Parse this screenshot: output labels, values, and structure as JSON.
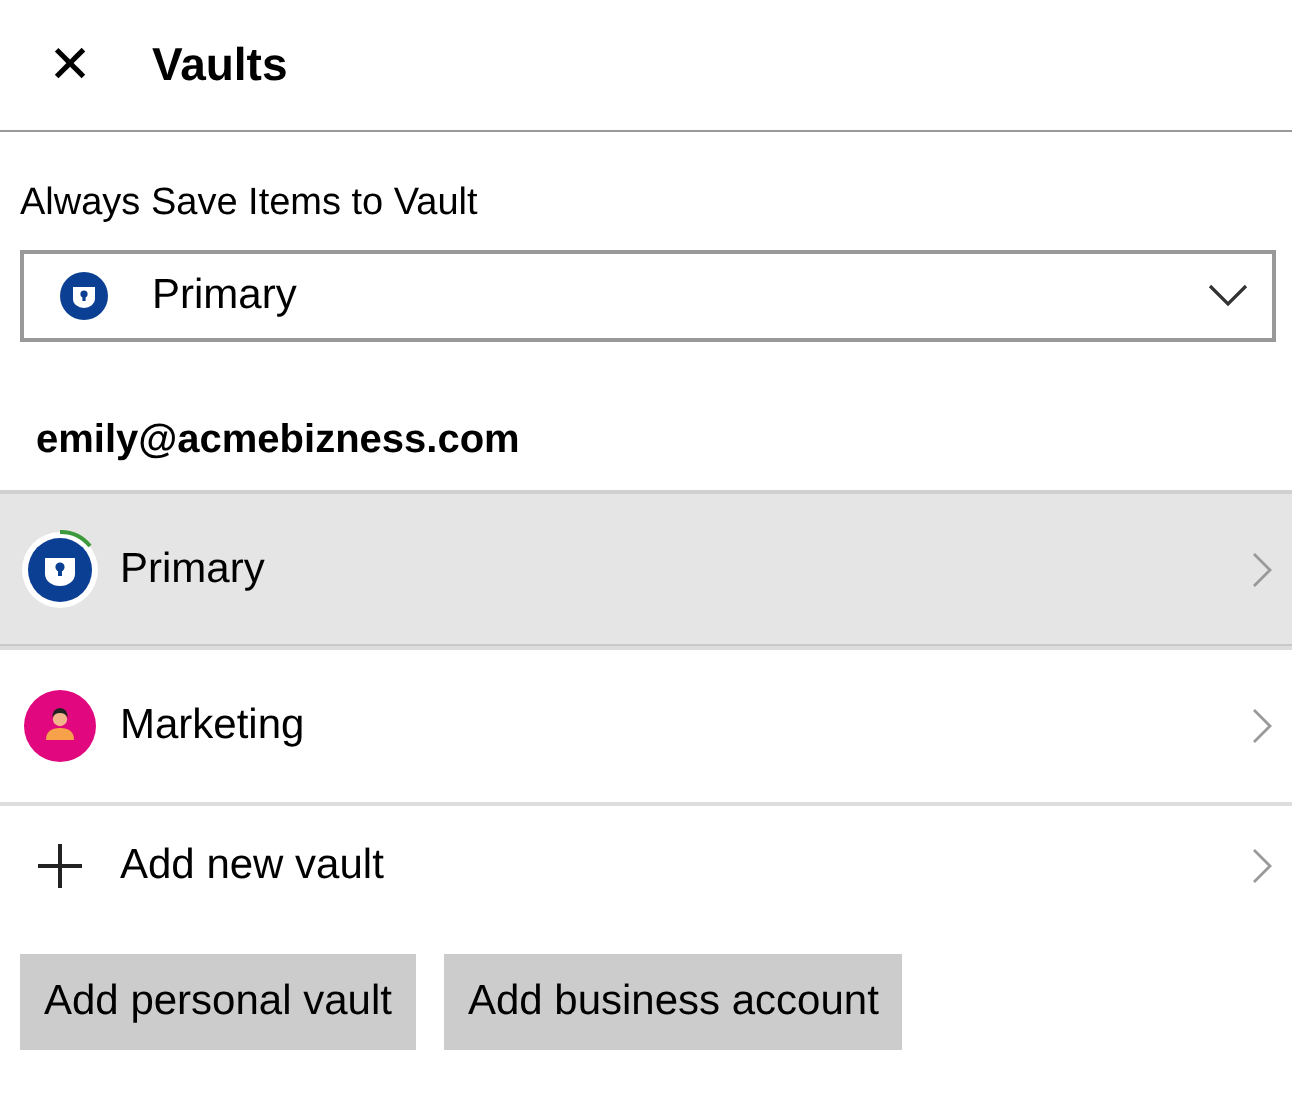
{
  "header": {
    "close_icon": "✕",
    "title": "Vaults"
  },
  "default_vault": {
    "label": "Always Save Items to Vault",
    "value": "Primary",
    "color": "#0b3f94"
  },
  "account": {
    "email": "emily@acmebizness.com",
    "vaults": [
      {
        "kind": "vault",
        "name": "Primary",
        "selected": true,
        "color": "#0b3f94"
      },
      {
        "kind": "person",
        "name": "Marketing",
        "selected": false,
        "color": "#e0077f"
      },
      {
        "kind": "add",
        "name": "Add new vault",
        "selected": false
      }
    ]
  },
  "buttons": [
    "Add personal vault",
    "Add business account"
  ]
}
